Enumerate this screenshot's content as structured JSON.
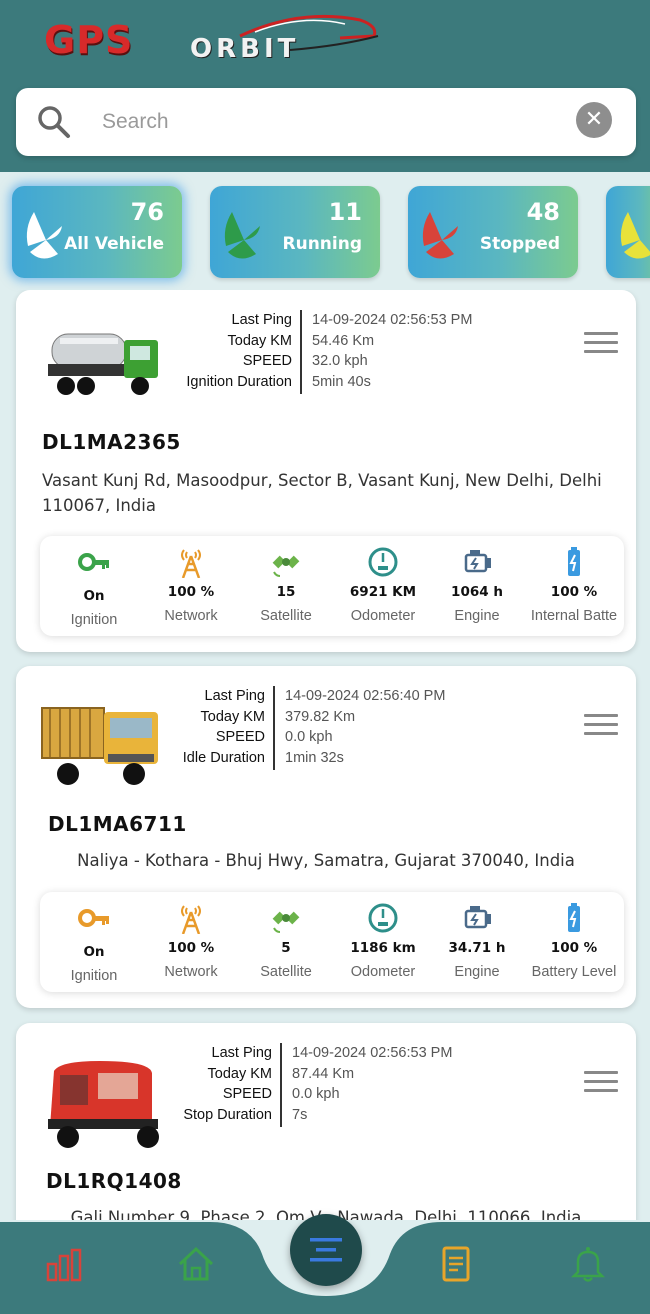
{
  "app": {
    "logo_text_gps": "GPS",
    "logo_text_orbit": "ORBIT"
  },
  "search": {
    "placeholder": "Search",
    "value": ""
  },
  "filters": [
    {
      "count": "76",
      "label": "All Vehicle",
      "color": "#3fa6d6",
      "pie_color": "#ffffff"
    },
    {
      "count": "11",
      "label": "Running",
      "color": "#5bb7c0",
      "pie_color": "#2e9b4a"
    },
    {
      "count": "48",
      "label": "Stopped",
      "color": "#5bb7c0",
      "pie_color": "#d8433a"
    }
  ],
  "vehicles": [
    {
      "plate": "DL1MA2365",
      "info_keys": [
        "Last Ping",
        "Today KM",
        "SPEED",
        "Ignition Duration"
      ],
      "info_vals": [
        "14-09-2024 02:56:53 PM",
        "54.46 Km",
        "32.0 kph",
        "5min 40s"
      ],
      "address": "Vasant Kunj Rd, Masoodpur, Sector B, Vasant Kunj, New Delhi, Delhi 110067, India",
      "stats": [
        {
          "value": "On",
          "label": "Ignition",
          "icon": "key-icon",
          "color": "#3aa34a"
        },
        {
          "value": "100 %",
          "label": "Network",
          "icon": "tower-icon",
          "color": "#e89a2a"
        },
        {
          "value": "15",
          "label": "Satellite",
          "icon": "satellite-icon",
          "color": "#6cb34a"
        },
        {
          "value": "6921 KM",
          "label": "Odometer",
          "icon": "odometer-icon",
          "color": "#2e8f8a"
        },
        {
          "value": "1064 h",
          "label": "Engine",
          "icon": "engine-icon",
          "color": "#4a6a8a"
        },
        {
          "value": "100 %",
          "label": "Internal Batte",
          "icon": "battery-icon",
          "color": "#3a9ae0"
        }
      ]
    },
    {
      "plate": "DL1MA6711",
      "info_keys": [
        "Last Ping",
        "Today KM",
        "SPEED",
        "Idle Duration"
      ],
      "info_vals": [
        "14-09-2024 02:56:40 PM",
        "379.82 Km",
        "0.0 kph",
        "1min 32s"
      ],
      "address": "Naliya - Kothara - Bhuj Hwy, Samatra, Gujarat 370040, India",
      "stats": [
        {
          "value": "On",
          "label": "Ignition",
          "icon": "key-icon",
          "color": "#e89a2a"
        },
        {
          "value": "100 %",
          "label": "Network",
          "icon": "tower-icon",
          "color": "#e89a2a"
        },
        {
          "value": "5",
          "label": "Satellite",
          "icon": "satellite-icon",
          "color": "#6cb34a"
        },
        {
          "value": "1186 km",
          "label": "Odometer",
          "icon": "odometer-icon",
          "color": "#2e8f8a"
        },
        {
          "value": "34.71 h",
          "label": "Engine",
          "icon": "engine-icon",
          "color": "#4a6a8a"
        },
        {
          "value": "100 %",
          "label": "Battery Level",
          "icon": "battery-icon",
          "color": "#3a9ae0"
        }
      ]
    },
    {
      "plate": "DL1RQ1408",
      "info_keys": [
        "Last Ping",
        "Today KM",
        "SPEED",
        "Stop Duration"
      ],
      "info_vals": [
        "14-09-2024 02:56:53 PM",
        "87.44 Km",
        "0.0 kph",
        "7s"
      ],
      "address": "Gali Number 9, Phase 2, Om V   , Nawada, Delhi, 110066, India"
    }
  ],
  "nav": {
    "items": [
      "stats-icon",
      "home-icon",
      "list-icon",
      "report-icon",
      "bell-icon"
    ],
    "colors": {
      "stats": "#d8433a",
      "home": "#3aa34a",
      "center": "#3a7ae0",
      "report": "#e8a52a",
      "bell": "#3aa34a"
    }
  }
}
